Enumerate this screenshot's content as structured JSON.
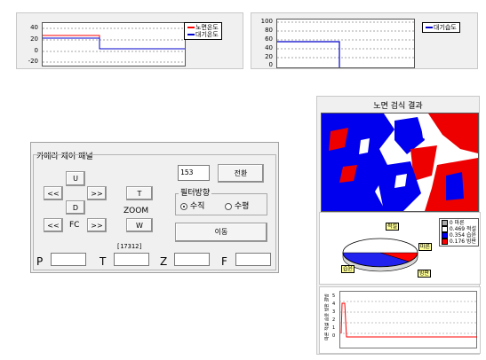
{
  "top_chart_left": {
    "legend": [
      {
        "label": "노면온도",
        "color": "#ff0000"
      },
      {
        "label": "대기온도",
        "color": "#0000cc"
      }
    ],
    "y_ticks": [
      "40",
      "20",
      "0",
      "-20"
    ]
  },
  "top_chart_right": {
    "legend": [
      {
        "label": "대기습도",
        "color": "#0000cc"
      }
    ],
    "y_ticks": [
      "100",
      "80",
      "60",
      "40",
      "20",
      "0"
    ]
  },
  "right_panel": {
    "title": "노면 검식 결과",
    "pie_legend": [
      "0 마른",
      "0.469 적설",
      "0.354 습윤",
      "0.176 빙판"
    ],
    "pie_legend_colors": [
      "#ffffff",
      "#ffffff",
      "#0000ff",
      "#ff0000"
    ],
    "pie_labels": [
      "적설",
      "마른",
      "빙판",
      "습윤"
    ],
    "bottom_chart_ylabel": "마른 적설 습윤 빙판 결빙",
    "bottom_chart_ticks": [
      "5",
      "4",
      "3",
      "2",
      "1",
      "0"
    ]
  },
  "camera_panel": {
    "title": "카메라 제어 패널",
    "buttons": {
      "up": "U",
      "left": "<<",
      "right": ">>",
      "down": "D",
      "tele": "T",
      "zoom_label": "ZOOM",
      "wide": "W",
      "fc_left": "<<",
      "fc_label": "FC",
      "fc_right": ">>",
      "switch": "전환",
      "move": "이동"
    },
    "channel_value": "153",
    "filter": {
      "title": "필터방향",
      "options": [
        "수직",
        "수평"
      ],
      "selected": "수직"
    },
    "counter": "[17312]",
    "fields": {
      "p_label": "P",
      "t_label": "T",
      "z_label": "Z",
      "f_label": "F",
      "p_value": "",
      "t_value": "",
      "z_value": "",
      "f_value": ""
    }
  }
}
